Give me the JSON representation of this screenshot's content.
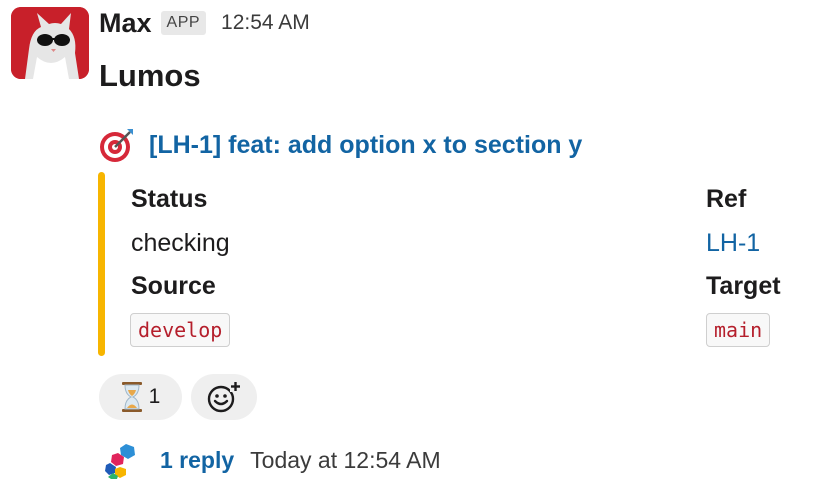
{
  "message": {
    "sender": "Max",
    "badge": "APP",
    "time": "12:54 AM",
    "text": "Lumos"
  },
  "attachment": {
    "title": "[LH-1] feat: add option x to section y",
    "accent_color": "#f7b500",
    "icon": "direct-hit-target-icon",
    "fields": {
      "status_label": "Status",
      "status_value": "checking",
      "ref_label": "Ref",
      "ref_value": "LH-1",
      "source_label": "Source",
      "source_value": "develop",
      "target_label": "Target",
      "target_value": "main"
    }
  },
  "reactions": [
    {
      "emoji": "hourglass-icon",
      "count": "1"
    }
  ],
  "add_reaction_icon": "add-reaction-icon",
  "thread": {
    "replies": "1 reply",
    "last_reply": "Today at 12:54 AM"
  },
  "colors": {
    "link": "#1264a3",
    "code": "#b51f2c",
    "avatar_bg": "#c8202a"
  }
}
